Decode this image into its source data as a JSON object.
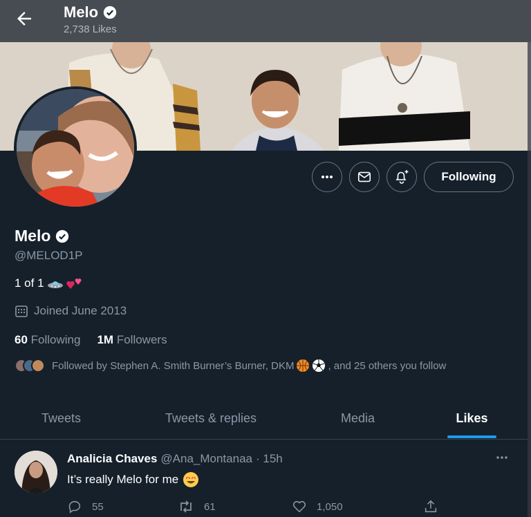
{
  "header": {
    "title": "Melo",
    "likes_count": "2,738 Likes"
  },
  "profile": {
    "name": "Melo",
    "handle": "@MELOD1P",
    "bio": "1 of 1",
    "joined": "Joined June 2013",
    "following_count": "60",
    "following_label": "Following",
    "followers_count": "1M",
    "followers_label": "Followers",
    "followed_by": "Followed by Stephen A. Smith Burner’s Burner, DKM",
    "followed_by_suffix": ", and 25 others you follow"
  },
  "actions": {
    "follow_label": "Following"
  },
  "tabs": [
    {
      "label": "Tweets"
    },
    {
      "label": "Tweets & replies"
    },
    {
      "label": "Media"
    },
    {
      "label": "Likes",
      "active": true
    }
  ],
  "tweet": {
    "author": "Analicia Chaves",
    "handle": "@Ana_Montanaa",
    "time": "· 15h",
    "text": "It’s really Melo for me",
    "replies": "55",
    "retweets": "61",
    "likes": "1,050"
  },
  "colors": {
    "background": "#15202b",
    "accent": "#1d9bf0",
    "muted": "#8b98a5"
  },
  "icons": [
    "back-arrow-icon",
    "verified-badge-icon",
    "more-icon",
    "message-icon",
    "notification-bell-icon",
    "calendar-icon",
    "reply-icon",
    "retweet-icon",
    "like-icon",
    "share-icon"
  ]
}
